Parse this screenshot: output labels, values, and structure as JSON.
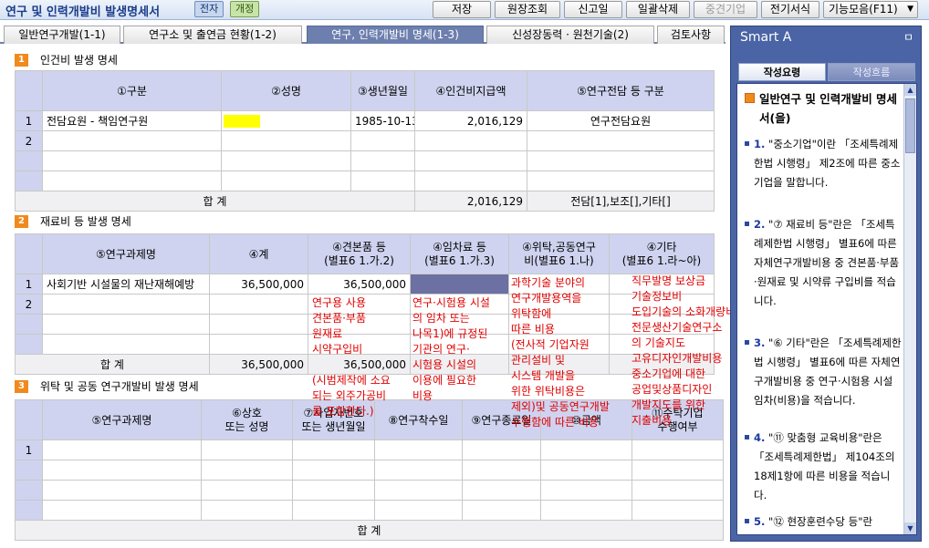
{
  "titlebar": {
    "title": "연구 및 인력개발비 발생명세서",
    "badge_a": "전자",
    "badge_b": "개정",
    "buttons": [
      "저장",
      "원장조회",
      "신고일",
      "일괄삭제",
      "중견기업",
      "전기서식",
      "기능모음(F11)"
    ]
  },
  "tabs": [
    "일반연구개발(1-1)",
    "연구소 및 출연금 현황(1-2)",
    "연구, 인력개발비 명세(1-3)",
    "신성장동력 · 원천기술(2)",
    "검토사항"
  ],
  "active_tab": 2,
  "section1": {
    "num": "1",
    "title": "인건비 발생 명세",
    "headers": [
      "①구분",
      "②성명",
      "③생년월일",
      "④인건비지급액",
      "⑤연구전담 등 구분"
    ],
    "rows": [
      {
        "no": "1",
        "gubun": "전담요원 - 책임연구원",
        "name": "",
        "birth": "1985-10-13",
        "amount": "2,016,129",
        "type": "연구전담요원"
      },
      {
        "no": "2",
        "gubun": "",
        "name": "",
        "birth": "",
        "amount": "",
        "type": ""
      }
    ],
    "total_label": "합  계",
    "total_amount": "2,016,129",
    "total_type": "전담[1],보조[],기타[]"
  },
  "section2": {
    "num": "2",
    "title": "재료비 등 발생 명세",
    "headers": [
      "⑤연구과제명",
      "④계",
      "④견본품 등\n(별표6 1.가.2)",
      "④임차료 등\n(별표6 1.가.3)",
      "④위탁,공동연구\n비(별표6 1.나)",
      "④기타\n(별표6 1.라~아)"
    ],
    "rows": [
      {
        "no": "1",
        "project": "사회기반 시설물의 재난재해예방",
        "total": "36,500,000",
        "sample": "36,500,000",
        "rent": "",
        "consign": "",
        "etc": ""
      },
      {
        "no": "2",
        "project": "",
        "total": "",
        "sample": "",
        "rent": "",
        "consign": "",
        "etc": ""
      }
    ],
    "total_label": "합  계",
    "total_total": "36,500,000",
    "total_sample": "36,500,000",
    "notes": {
      "sample": [
        "연구용 사용",
        "견본품·부품",
        "원재료",
        "시약구입비",
        "",
        "(시범제작에 소요",
        "되는 외주가공비",
        "를 포함한다.)"
      ],
      "rent": [
        "연구·시험용 시설",
        "의 임차 또는",
        "나목1)에 규정된",
        "기관의 연구·",
        "시험용 시설의",
        "이용에 필요한",
        "비용"
      ],
      "consign": [
        "과학기술 분야의",
        "연구개발용역을",
        "위탁함에",
        "따른 비용",
        "(전사적 기업자원",
        "관리설비 및",
        "시스템 개발을",
        "위한 위탁비용은",
        "제외)및 공동연구개발",
        "수행함에 따른 비용"
      ],
      "etc": [
        "직무발명 보상금",
        "기술정보비",
        "도입기술의 소화개량비",
        "전문생산기술연구소",
        "의 기술지도",
        "고유디자인개발비용",
        "중소기업에 대한",
        "공업및상품디자인",
        "개발지도를 위한",
        "지출비용"
      ]
    }
  },
  "section3": {
    "num": "3",
    "title": "위탁 및 공동 연구개발비 발생 명세",
    "headers": [
      "⑤연구과제명",
      "⑥상호\n또는 성명",
      "⑦사업자번호\n또는 생년월일",
      "⑧연구착수일",
      "⑨연구종료일",
      "⑩금액",
      "⑪수탁기업\n수행여부"
    ],
    "rows": [
      {
        "no": "1"
      },
      {
        "no": ""
      },
      {
        "no": ""
      },
      {
        "no": ""
      }
    ],
    "total_label": "합  계"
  },
  "panel": {
    "title": "Smart A",
    "pin": "ㅁ",
    "tab_on": "작성요령",
    "tab_off": "작성흐름",
    "heading": "일반연구 및 인력개발비 명세서(을)",
    "items": [
      {
        "n": "1.",
        "text": "\"중소기업\"이란 「조세특례제한법 시행령」 제2조에 따른 중소기업을 말합니다."
      },
      {
        "n": "2.",
        "text": "\"⑦ 재료비 등\"란은 「조세특례제한법 시행령」 별표6에 따른 자체연구개발비용 중 견본품·부품·원재료 및 시약류 구입비를 적습니다."
      },
      {
        "n": "3.",
        "text": "\"⑥ 기타\"란은 「조세특례제한법 시행령」 별표6에 따른 자체연구개발비용 중 연구·시험용 시설 임차(비용)을 적습니다."
      },
      {
        "n": "4.",
        "text": "\"⑪ 맞춤형 교육비용\"란은 「조세특례제한법」 제104조의18제1항에 따른 비용을 적습니다."
      },
      {
        "n": "5.",
        "text": "\"⑫ 현장훈련수당 등\"란"
      }
    ]
  },
  "colors": {
    "accent": "#6d7fae",
    "header_fill": "#cfd3ef",
    "section_badge": "#f08a1c",
    "note_text": "#e00000",
    "panel_bg": "#4a64a5"
  }
}
